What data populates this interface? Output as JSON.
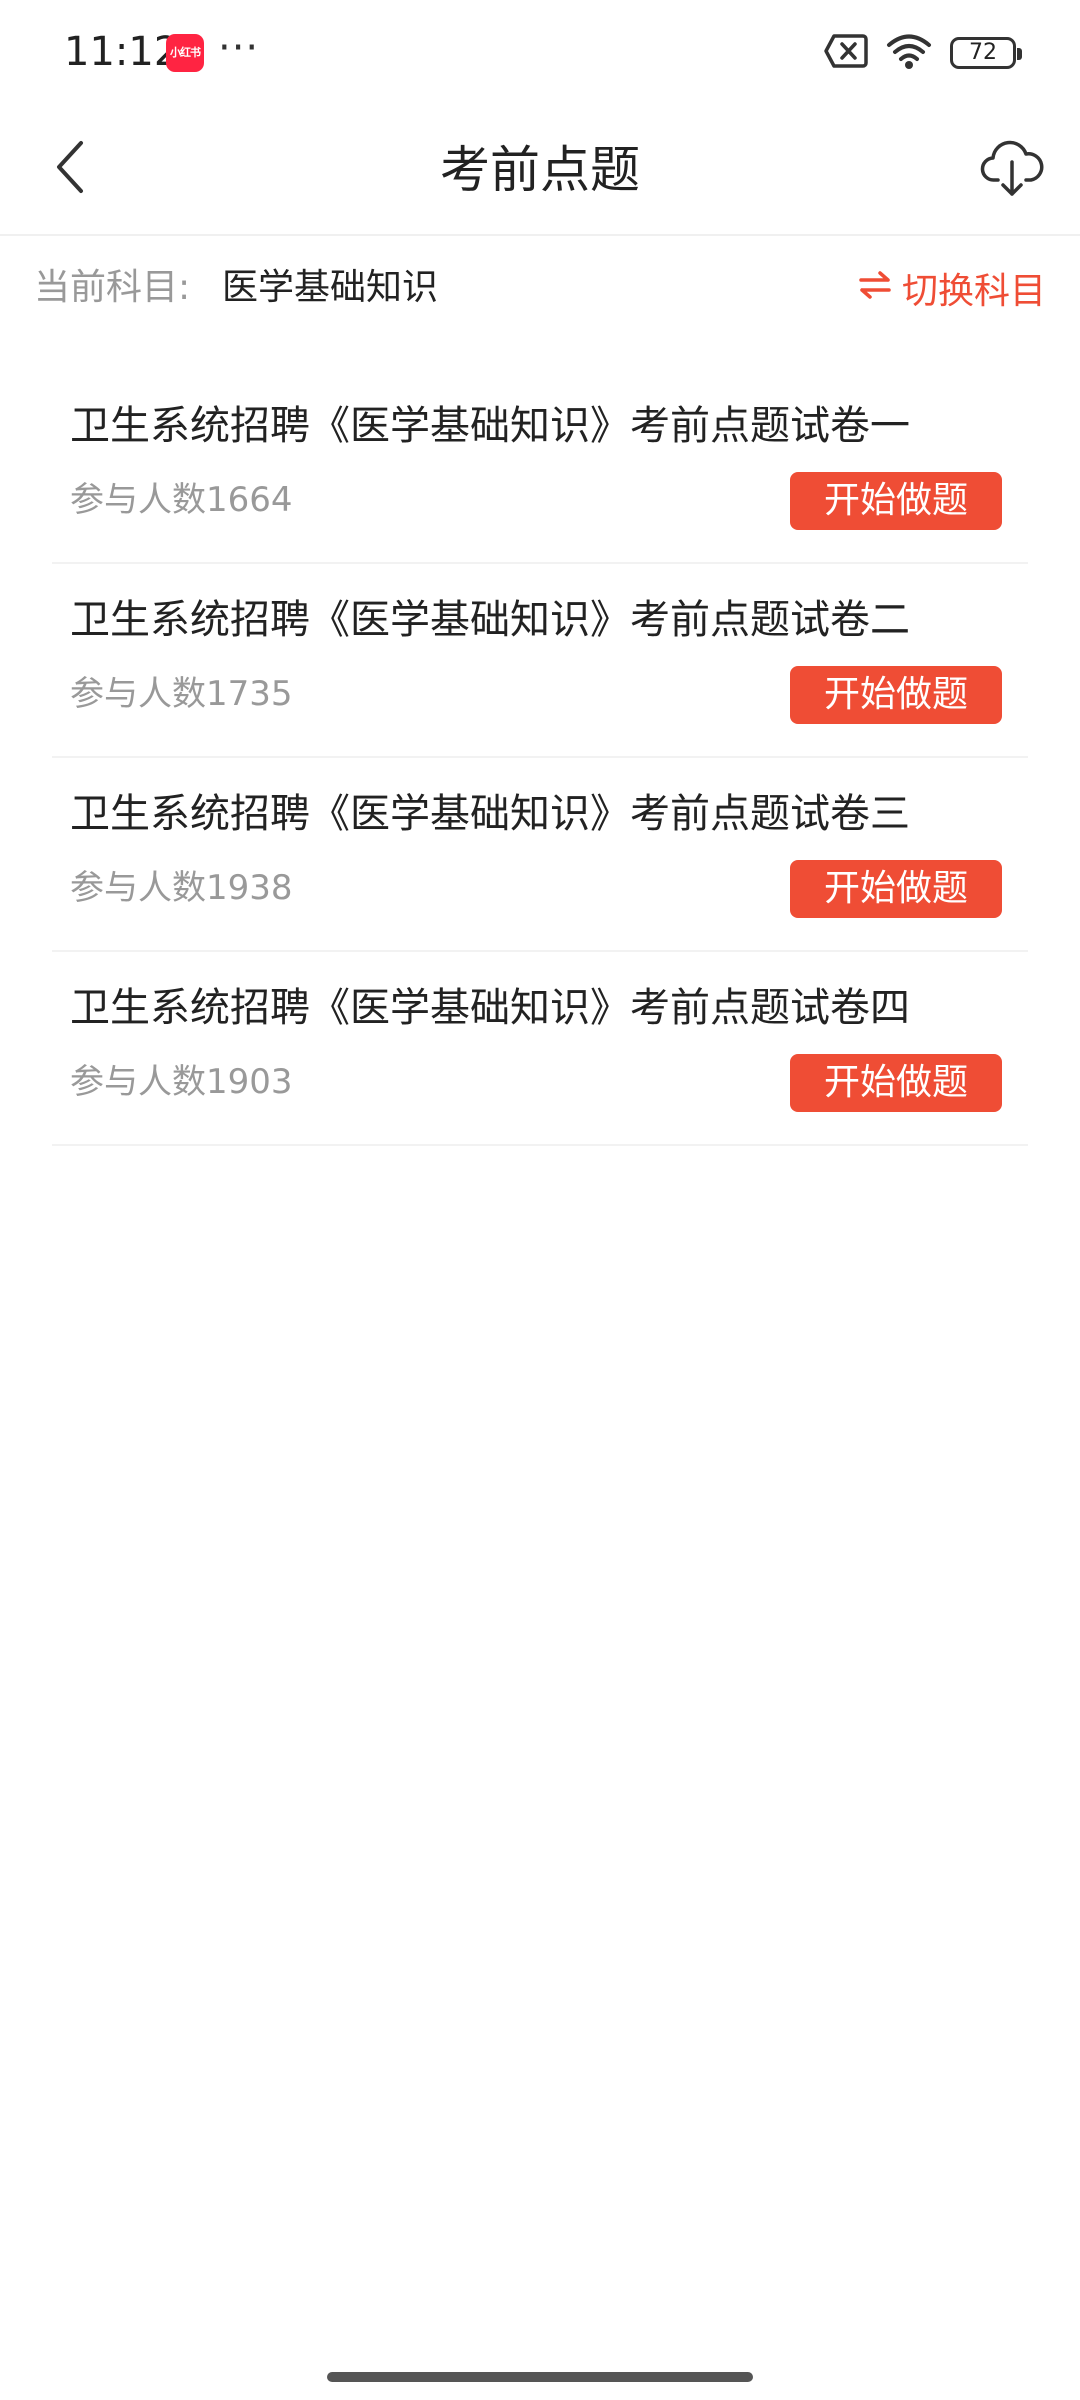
{
  "status_bar": {
    "time": "11:12",
    "app_badge_text": "小红书",
    "dots": "···",
    "battery_level": "72",
    "icons": [
      "notification-off-icon",
      "wifi-icon",
      "battery-icon"
    ]
  },
  "nav": {
    "title": "考前点题",
    "back_icon": "chevron-left-icon",
    "download_icon": "cloud-download-icon"
  },
  "subject": {
    "label": "当前科目:",
    "value": "医学基础知识",
    "switch_label": "切换科目",
    "switch_icon": "swap-arrows-icon"
  },
  "papers": [
    {
      "title": "卫生系统招聘《医学基础知识》考前点题试卷一",
      "participants": "参与人数1664",
      "button": "开始做题"
    },
    {
      "title": "卫生系统招聘《医学基础知识》考前点题试卷二",
      "participants": "参与人数1735",
      "button": "开始做题"
    },
    {
      "title": "卫生系统招聘《医学基础知识》考前点题试卷三",
      "participants": "参与人数1938",
      "button": "开始做题"
    },
    {
      "title": "卫生系统招聘《医学基础知识》考前点题试卷四",
      "participants": "参与人数1903",
      "button": "开始做题"
    }
  ],
  "colors": {
    "accent": "#ef4d35",
    "secondary_text": "#999999",
    "primary_text": "#222222",
    "app_badge": "#ff2442"
  }
}
